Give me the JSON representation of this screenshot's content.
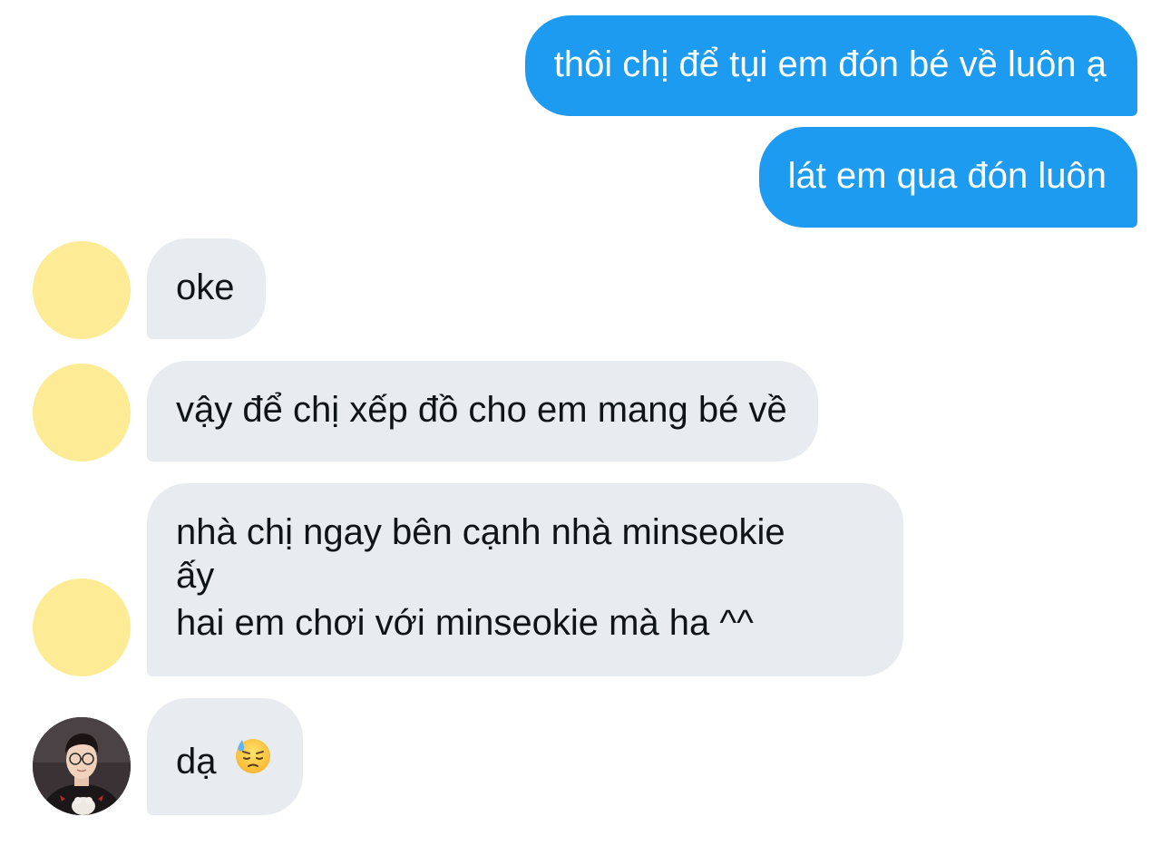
{
  "conversation": {
    "messages": [
      {
        "direction": "outgoing",
        "text": "thôi chị để tụi em đón bé về luôn ạ"
      },
      {
        "direction": "outgoing",
        "text": "lát em qua đón luôn"
      },
      {
        "direction": "incoming",
        "text": "oke"
      },
      {
        "direction": "incoming",
        "text": "vậy để chị xếp đồ cho em mang bé về"
      },
      {
        "direction": "incoming",
        "lines": [
          "nhà chị ngay bên cạnh nhà minseokie",
          "ấy",
          "hai em chơi với minseokie mà ha ^^"
        ]
      },
      {
        "direction": "incoming",
        "text": "dạ",
        "emoji": "downcast-face-with-sweat-icon"
      }
    ]
  },
  "colors": {
    "outgoing_bubble": "#1d9bf0",
    "incoming_bubble": "#e8ecf0",
    "avatar_placeholder": "#fdec95",
    "incoming_text": "#0f1419",
    "outgoing_text": "#ffffff"
  }
}
